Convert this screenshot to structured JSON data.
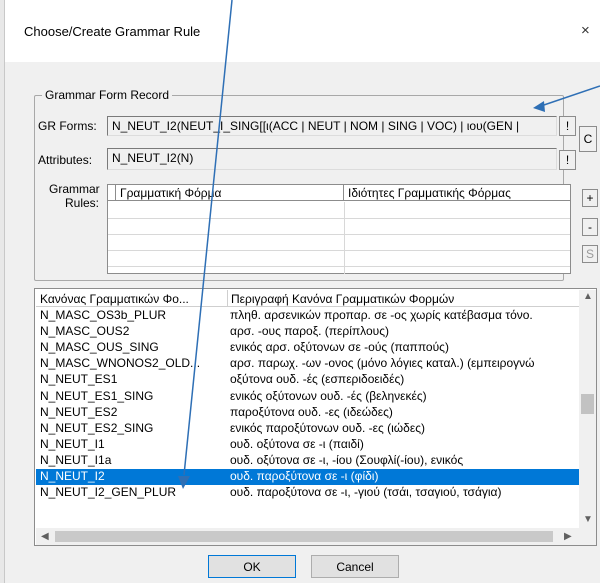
{
  "dialog": {
    "title": "Choose/Create Grammar Rule",
    "close_glyph": "×"
  },
  "group": {
    "legend": "Grammar Form Record",
    "gr_forms_label": "GR Forms:",
    "gr_forms_value": "N_NEUT_I2(NEUT_I_SING[[ι(ACC | NEUT | NOM | SING | VOC) | ιου(GEN | ",
    "attributes_label": "Attributes:",
    "attributes_value": "N_NEUT_I2(N)",
    "bang_label": "!",
    "c_label": "C",
    "rules_label_line1": "Grammar",
    "rules_label_line2": "Rules:",
    "rules_headers": [
      "Γραμματική Φόρμα",
      "Ιδιότητες Γραμματικής Φόρμας"
    ],
    "side_buttons": [
      "+",
      "-",
      "S"
    ]
  },
  "list": {
    "headers": [
      "Κανόνας Γραμματικών Φο...",
      "Περιγραφή Κανόνα Γραμματικών Φορμών"
    ],
    "rows": [
      [
        "N_MASC_OS3b_PLUR",
        "πληθ. αρσενικών προπαρ. σε -ος χωρίς κατέβασμα τόνο."
      ],
      [
        "N_MASC_OUS2",
        "αρσ. -ους παροξ. (περίπλους)"
      ],
      [
        "N_MASC_OUS_SING",
        "ενικός αρσ. οξύτονων σε -ούς (παππούς)"
      ],
      [
        "N_MASC_WNONOS2_OLD...",
        "αρσ. παρωχ. -ων -ονος (μόνο λόγιες καταλ.) (εμπειρογνώ"
      ],
      [
        "N_NEUT_ES1",
        "οξύτονα ουδ. -ές (εσπεριδοειδές)"
      ],
      [
        "N_NEUT_ES1_SING",
        "ενικός οξύτονων ουδ. -ές (βεληνεκές)"
      ],
      [
        "N_NEUT_ES2",
        "παροξύτονα ουδ. -ες (ιδεώδες)"
      ],
      [
        "N_NEUT_ES2_SING",
        "ενικός παροξύτονων ουδ. -ες (ιώδες)"
      ],
      [
        "N_NEUT_I1",
        "ουδ. οξύτονα σε -ι (παιδί)"
      ],
      [
        "N_NEUT_I1a",
        "ουδ. οξύτονα σε -ι, -ίου (Σουφλί(-ίου), ενικός"
      ],
      [
        "N_NEUT_I2",
        "ουδ. παροξύτονα σε -ι (φίδι)"
      ],
      [
        "N_NEUT_I2_GEN_PLUR",
        "ουδ. παροξύτονα σε -ι, -γιού (τσάι, τσαγιού, τσάγια)"
      ]
    ],
    "selected_index": 10
  },
  "footer": {
    "ok_label": "OK",
    "cancel_label": "Cancel"
  },
  "colors": {
    "selection": "#0078d7",
    "annotation_arrow": "#2e6fb5"
  },
  "icons": [
    "close-icon",
    "scroll-up-icon",
    "scroll-down-icon",
    "scroll-left-icon",
    "scroll-right-icon"
  ]
}
